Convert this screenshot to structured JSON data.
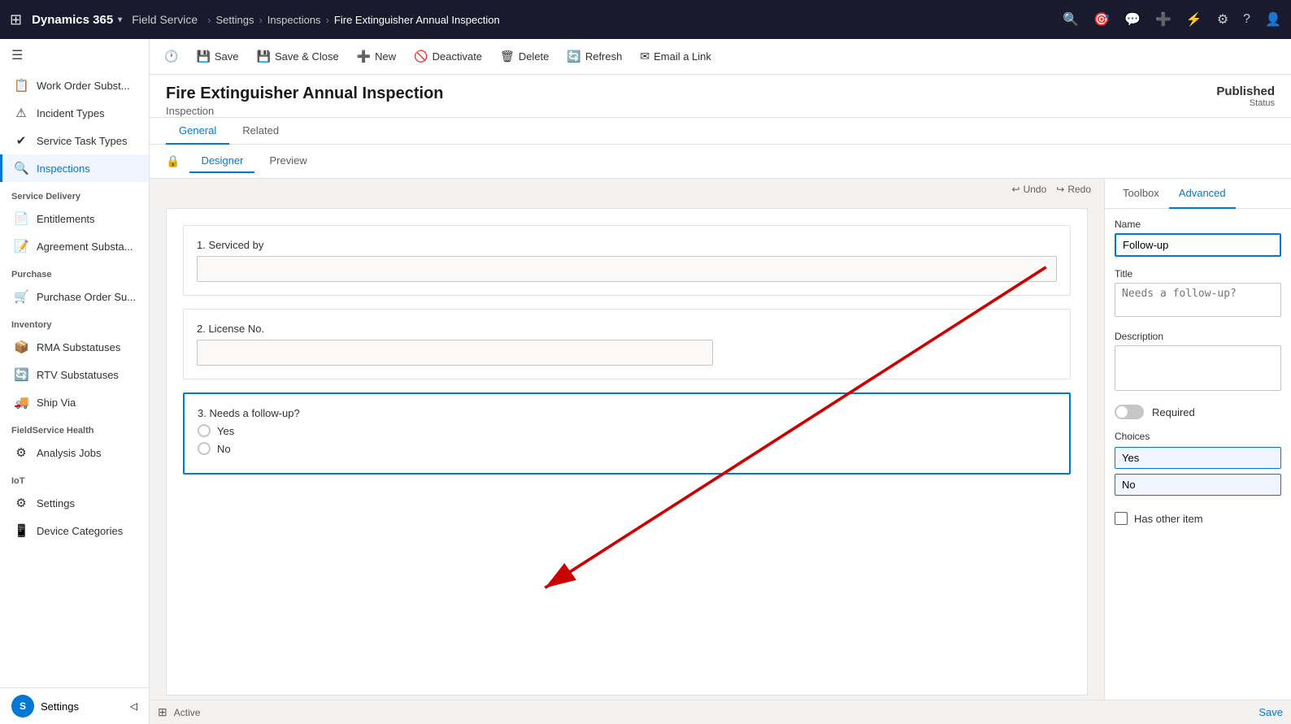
{
  "topNav": {
    "appsIcon": "⊞",
    "brand": "Dynamics 365",
    "chevron": "▾",
    "module": "Field Service",
    "breadcrumb": [
      "Settings",
      "Inspections",
      "Fire Extinguisher Annual Inspection"
    ],
    "icons": [
      "🔍",
      "✓",
      "💬",
      "+",
      "⚡",
      "⚙",
      "?",
      "👤"
    ]
  },
  "sidebar": {
    "toggleIcon": "☰",
    "items": [
      {
        "icon": "📋",
        "label": "Work Order Subst...",
        "active": false
      },
      {
        "icon": "⚠",
        "label": "Incident Types",
        "active": false
      },
      {
        "icon": "✔",
        "label": "Service Task Types",
        "active": false
      },
      {
        "icon": "🔍",
        "label": "Inspections",
        "active": true
      }
    ],
    "sections": [
      {
        "label": "Service Delivery",
        "items": [
          {
            "icon": "📄",
            "label": "Entitlements",
            "active": false
          },
          {
            "icon": "📝",
            "label": "Agreement Substa...",
            "active": false
          }
        ]
      },
      {
        "label": "Purchase",
        "items": [
          {
            "icon": "🛒",
            "label": "Purchase Order Su...",
            "active": false
          }
        ]
      },
      {
        "label": "Inventory",
        "items": [
          {
            "icon": "📦",
            "label": "RMA Substatuses",
            "active": false
          },
          {
            "icon": "🔄",
            "label": "RTV Substatuses",
            "active": false
          },
          {
            "icon": "🚚",
            "label": "Ship Via",
            "active": false
          }
        ]
      },
      {
        "label": "FieldService Health",
        "items": [
          {
            "icon": "⚙",
            "label": "Analysis Jobs",
            "active": false
          }
        ]
      },
      {
        "label": "IoT",
        "items": [
          {
            "icon": "⚙",
            "label": "Settings",
            "active": false
          },
          {
            "icon": "📱",
            "label": "Device Categories",
            "active": false
          }
        ]
      }
    ],
    "bottomUser": {
      "avatar": "S",
      "label": "Settings"
    }
  },
  "commandBar": {
    "buttons": [
      {
        "icon": "💾",
        "label": "Save"
      },
      {
        "icon": "💾",
        "label": "Save & Close"
      },
      {
        "icon": "+",
        "label": "New"
      },
      {
        "icon": "🚫",
        "label": "Deactivate"
      },
      {
        "icon": "🗑",
        "label": "Delete"
      },
      {
        "icon": "🔄",
        "label": "Refresh"
      },
      {
        "icon": "✉",
        "label": "Email a Link"
      }
    ]
  },
  "record": {
    "title": "Fire Extinguisher Annual Inspection",
    "subtitle": "Inspection",
    "statusValue": "Published",
    "statusLabel": "Status"
  },
  "tabs": {
    "items": [
      "General",
      "Related"
    ],
    "active": "General"
  },
  "subTabs": {
    "items": [
      "Designer",
      "Preview"
    ],
    "active": "Designer"
  },
  "undoRedo": {
    "undoLabel": "Undo",
    "redoLabel": "Redo"
  },
  "canvas": {
    "questions": [
      {
        "number": "1.",
        "label": "Serviced by",
        "type": "text"
      },
      {
        "number": "2.",
        "label": "License No.",
        "type": "text"
      },
      {
        "number": "3.",
        "label": "Needs a follow-up?",
        "type": "radio",
        "options": [
          "Yes",
          "No"
        ],
        "highlighted": true
      }
    ]
  },
  "rightPanel": {
    "tabs": [
      "Toolbox",
      "Advanced"
    ],
    "activeTab": "Advanced",
    "fields": {
      "nameLabel": "Name",
      "nameValue": "Follow-up",
      "titleLabel": "Title",
      "titlePlaceholder": "Needs a follow-up?",
      "descriptionLabel": "Description",
      "descriptionValue": "",
      "requiredLabel": "Required",
      "requiredToggleOn": false,
      "choicesLabel": "Choices",
      "choices": [
        "Yes",
        "No"
      ],
      "hasOtherLabel": "Has other item"
    }
  },
  "statusBar": {
    "icon": "⊞",
    "statusLabel": "Active",
    "saveLabel": "Save"
  }
}
